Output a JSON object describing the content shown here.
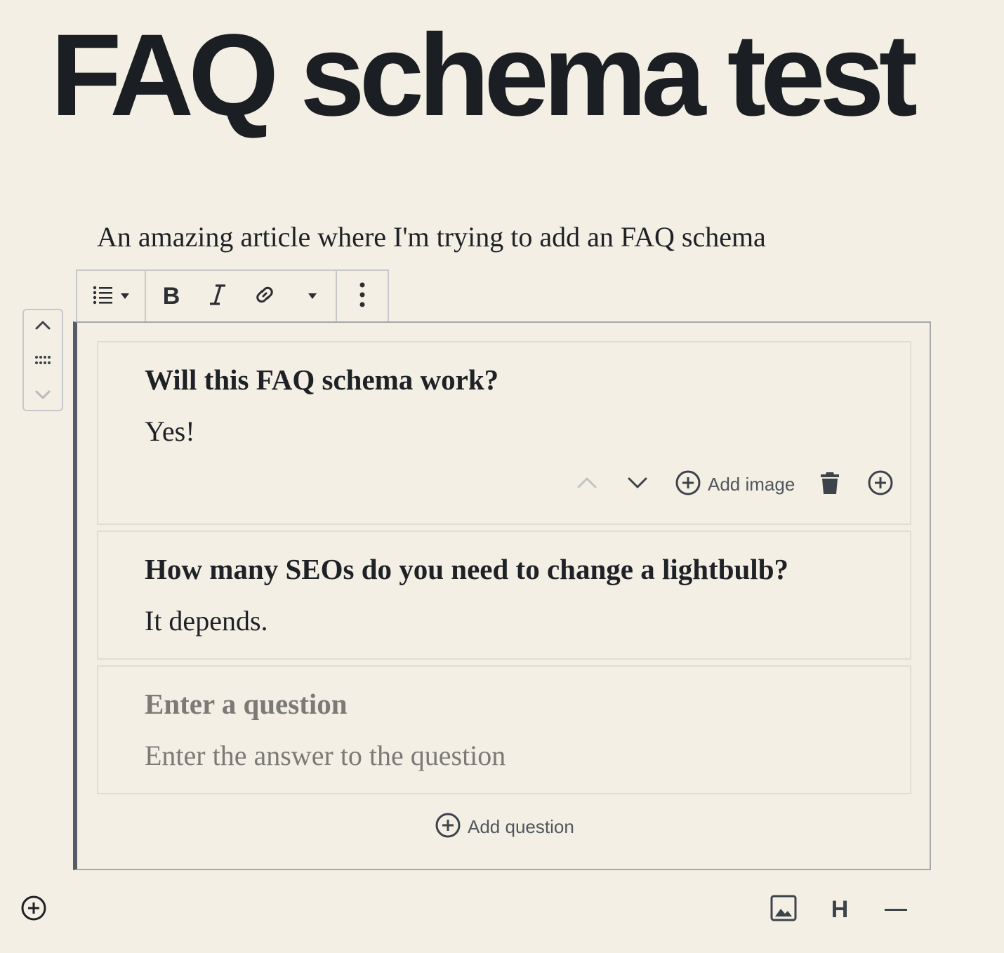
{
  "post": {
    "title": "FAQ schema test",
    "intro": "An amazing article where I'm trying to add an FAQ schema"
  },
  "toolbar": {
    "buttons": [
      "list-icon",
      "bold-icon",
      "italic-icon",
      "link-icon",
      "more-rich-text-icon",
      "more-options-icon"
    ],
    "bold_label": "B"
  },
  "faq": {
    "items": [
      {
        "question": "Will this FAQ schema work?",
        "answer": "Yes!"
      },
      {
        "question": "How many SEOs do you need to change a lightbulb?",
        "answer": "It depends."
      }
    ],
    "new_item": {
      "question_placeholder": "Enter a question",
      "answer_placeholder": "Enter the answer to the question"
    },
    "actions": {
      "add_image": "Add image"
    },
    "add_question": "Add question"
  },
  "inserter": {
    "heading_label": "H"
  },
  "colors": {
    "background": "#f4efe4",
    "text": "#1e2126",
    "placeholder": "#7b7a76",
    "block_border": "#a4a7ab",
    "selected_bar": "#555d66"
  }
}
